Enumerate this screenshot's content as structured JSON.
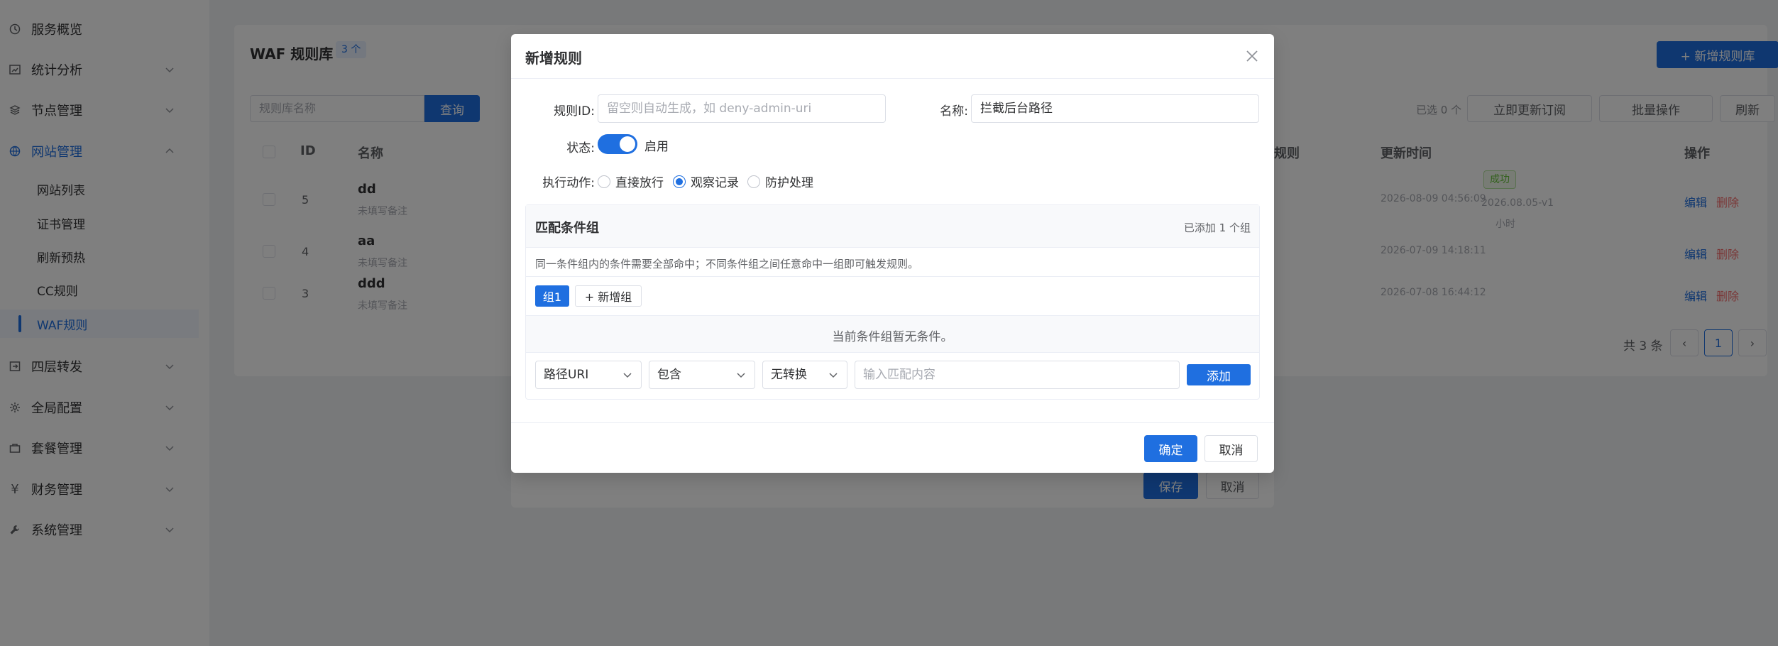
{
  "sidebar": {
    "items": [
      {
        "label": "服务概览",
        "icon": "dashboard-icon"
      },
      {
        "label": "统计分析",
        "icon": "chart-icon"
      },
      {
        "label": "节点管理",
        "icon": "layers-icon"
      },
      {
        "label": "网站管理",
        "icon": "globe-icon"
      },
      {
        "label": "四层转发",
        "icon": "forward-icon"
      },
      {
        "label": "全局配置",
        "icon": "gear-icon"
      },
      {
        "label": "套餐管理",
        "icon": "package-icon"
      },
      {
        "label": "财务管理",
        "icon": "yen-icon"
      },
      {
        "label": "系统管理",
        "icon": "wrench-icon"
      }
    ],
    "sub_items": [
      {
        "label": "网站列表"
      },
      {
        "label": "证书管理"
      },
      {
        "label": "刷新预热"
      },
      {
        "label": "CC规则"
      },
      {
        "label": "WAF规则"
      }
    ]
  },
  "background": {
    "title": "WAF 规则库",
    "count_badge": "3 个",
    "add_rule": "+ 新增规则库",
    "search_placeholder": "规则库名称",
    "query": "查询",
    "selected": "已选 0 个",
    "update_subscription": "立即更新订阅",
    "batch_ops": "批量操作",
    "refresh": "刷新",
    "columns": {
      "id": "ID",
      "name": "名称",
      "rules": "规则",
      "updated": "更新时间",
      "ops": "操作"
    },
    "rows": [
      {
        "id": "5",
        "name": "dd",
        "note": "未填写备注",
        "updated": "2026-08-09 04:56:09",
        "extra1": "2026.08.05-v1",
        "extra2": "小时"
      },
      {
        "id": "4",
        "name": "aa",
        "note": "未填写备注",
        "updated": "2026-07-09 14:18:11"
      },
      {
        "id": "3",
        "name": "ddd",
        "note": "未填写备注",
        "updated": "2026-07-08 16:44:12"
      }
    ],
    "tag": "成功",
    "edit": "编辑",
    "delete": "删除",
    "total": "共 3 条",
    "page": "1",
    "save": "保存",
    "cancel": "取消"
  },
  "modal": {
    "title": "新增规则",
    "rule_id_label": "规则ID:",
    "rule_id_placeholder": "留空则自动生成，如 deny-admin-uri",
    "name_label": "名称:",
    "name_value": "拦截后台路径",
    "status_label": "状态:",
    "status_text": "启用",
    "status_enabled": true,
    "action_label": "执行动作:",
    "actions": [
      {
        "label": "直接放行",
        "checked": false
      },
      {
        "label": "观察记录",
        "checked": true
      },
      {
        "label": "防护处理",
        "checked": false
      }
    ],
    "group_title": "匹配条件组",
    "group_count": "已添加 1 个组",
    "group_tip": "同一条件组内的条件需要全部命中；不同条件组之间任意命中一组即可触发规则。",
    "group_tab": "组1",
    "add_group": "+ 新增组",
    "empty_text": "当前条件组暂无条件。",
    "field_select": "路径URI",
    "operator_select": "包含",
    "transform_select": "无转换",
    "match_placeholder": "输入匹配内容",
    "add_condition": "添加",
    "ok": "确定",
    "cancel": "取消"
  },
  "colors": {
    "primary": "#1f6fe0",
    "danger": "#f56c6c",
    "success": "#67c23a"
  }
}
